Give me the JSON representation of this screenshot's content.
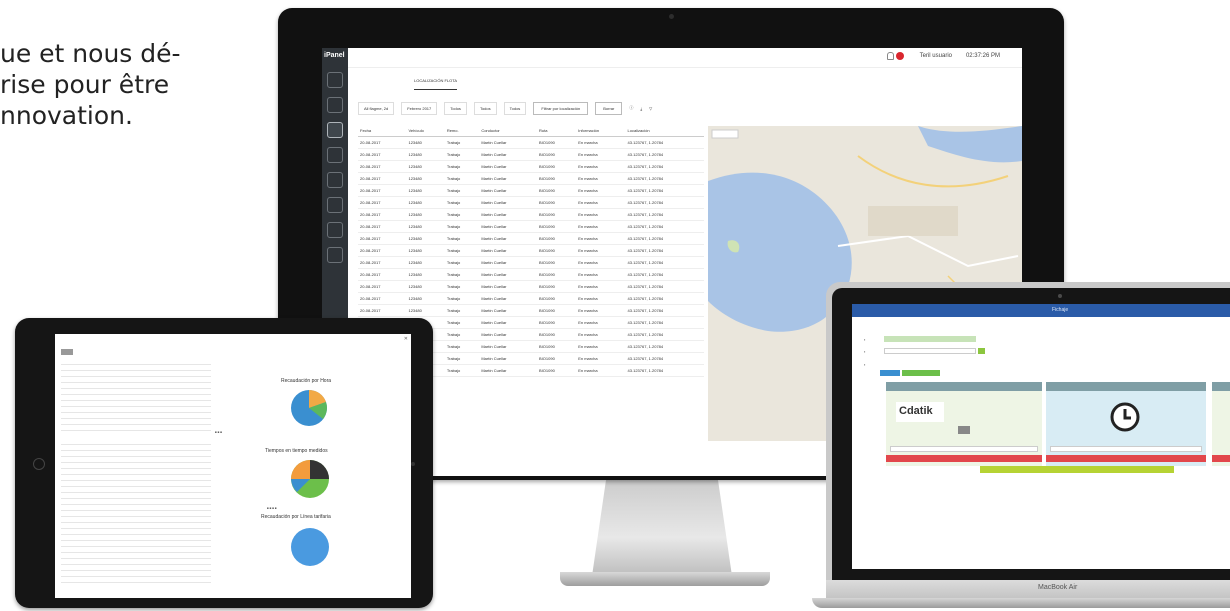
{
  "headline": {
    "line1": "ue et nous dé-",
    "line2": "rise pour être",
    "line3": "nnovation."
  },
  "imac_app": {
    "logo": "iPanel",
    "user": "Teril usuario",
    "time": "02:37:26 PM",
    "tabs": [
      "",
      "",
      "LOCALIZACIÓN FLOTA",
      "",
      "",
      "",
      ""
    ],
    "filters": {
      "fleet": "All flagme, 2d",
      "date": "Febrero 2017",
      "all_a": "Todos",
      "all_b": "Todos",
      "all_c": "Todos",
      "apply": "Filtrar por localización",
      "reset": "Borrar"
    },
    "table": {
      "headers": [
        "Fecha",
        "Vehículo",
        "Remo.",
        "Conductor",
        "Ruta",
        "Información",
        "Localización"
      ],
      "row": [
        "20-08-2017",
        "123480",
        "Trabajo",
        "Martín Cuellar",
        "BIO1090",
        "En marcha",
        "43.123767, 1.20784"
      ],
      "row_count": 20
    },
    "sidebar_icons": [
      "dashboard-icon",
      "location-icon",
      "chat-icon",
      "settings-icon",
      "user-icon",
      "device-icon",
      "report-icon",
      "list-icon"
    ],
    "colors": {
      "sidebar": "#2e3338",
      "notification": "#d9262e",
      "map_water": "#a9c4e6",
      "map_land": "#eae6dc"
    }
  },
  "ipad_app": {
    "pie1": {
      "title": "Recaudación por Hora",
      "colors": [
        "#3a8fd0",
        "#f2a945",
        "#5cb85c"
      ]
    },
    "pie2": {
      "title": "Tiempos en tiempo medidos",
      "colors": [
        "#3a8fd0",
        "#6cbf4a",
        "#333333",
        "#f39c3d"
      ]
    },
    "pie3": {
      "title": "Recaudación por Línea tarifaria",
      "colors": [
        "#3a8fd0"
      ]
    }
  },
  "macbook_app": {
    "window_title": "Fichaje",
    "brand": "MacBook Air",
    "company_logo": "Cdatik",
    "colors": {
      "titlebar": "#2a5ba8",
      "card_head": "#7f9ea5",
      "danger": "#e2474b",
      "accent": "#b6d334",
      "clock_card": "#d8ecf4"
    }
  }
}
